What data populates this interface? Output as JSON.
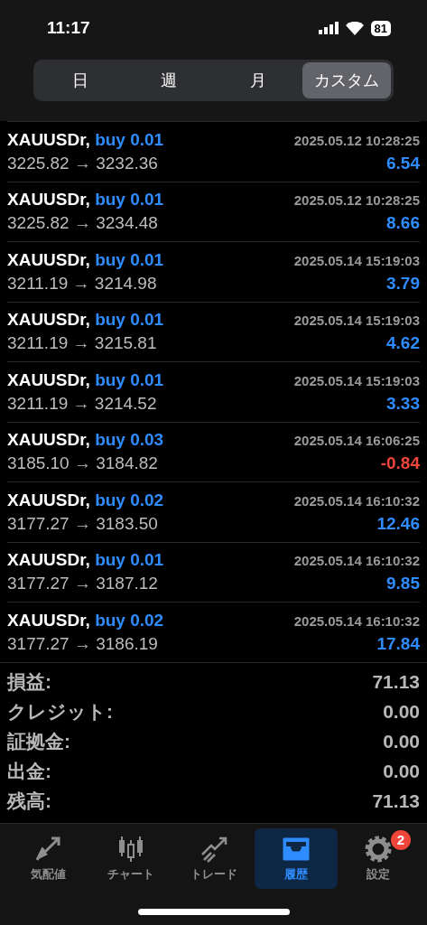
{
  "status_bar": {
    "time": "11:17",
    "battery": "81"
  },
  "segments": [
    {
      "label": "日",
      "selected": false
    },
    {
      "label": "週",
      "selected": false
    },
    {
      "label": "月",
      "selected": false
    },
    {
      "label": "カスタム",
      "selected": true
    }
  ],
  "deals": [
    {
      "symbol": "XAUUSDr,",
      "side": "buy 0.01",
      "time": "2025.05.12 10:28:25",
      "prices": "3225.82 → 3232.36",
      "profit": "6.54",
      "color": "#2f8cff"
    },
    {
      "symbol": "XAUUSDr,",
      "side": "buy 0.01",
      "time": "2025.05.12 10:28:25",
      "prices": "3225.82 → 3234.48",
      "profit": "8.66",
      "color": "#2f8cff"
    },
    {
      "symbol": "XAUUSDr,",
      "side": "buy 0.01",
      "time": "2025.05.14 15:19:03",
      "prices": "3211.19 → 3214.98",
      "profit": "3.79",
      "color": "#2f8cff"
    },
    {
      "symbol": "XAUUSDr,",
      "side": "buy 0.01",
      "time": "2025.05.14 15:19:03",
      "prices": "3211.19 → 3215.81",
      "profit": "4.62",
      "color": "#2f8cff"
    },
    {
      "symbol": "XAUUSDr,",
      "side": "buy 0.01",
      "time": "2025.05.14 15:19:03",
      "prices": "3211.19 → 3214.52",
      "profit": "3.33",
      "color": "#2f8cff"
    },
    {
      "symbol": "XAUUSDr,",
      "side": "buy 0.03",
      "time": "2025.05.14 16:06:25",
      "prices": "3185.10 → 3184.82",
      "profit": "-0.84",
      "color": "#f0453a"
    },
    {
      "symbol": "XAUUSDr,",
      "side": "buy 0.02",
      "time": "2025.05.14 16:10:32",
      "prices": "3177.27 → 3183.50",
      "profit": "12.46",
      "color": "#2f8cff"
    },
    {
      "symbol": "XAUUSDr,",
      "side": "buy 0.01",
      "time": "2025.05.14 16:10:32",
      "prices": "3177.27 → 3187.12",
      "profit": "9.85",
      "color": "#2f8cff"
    },
    {
      "symbol": "XAUUSDr,",
      "side": "buy 0.02",
      "time": "2025.05.14 16:10:32",
      "prices": "3177.27 → 3186.19",
      "profit": "17.84",
      "color": "#2f8cff"
    }
  ],
  "summary": [
    {
      "label": "損益:",
      "value": "71.13"
    },
    {
      "label": "クレジット:",
      "value": "0.00"
    },
    {
      "label": "証拠金:",
      "value": "0.00"
    },
    {
      "label": "出金:",
      "value": "0.00"
    },
    {
      "label": "残高:",
      "value": "71.13"
    }
  ],
  "tab_bar": [
    {
      "kind": "quotes",
      "label": "気配値",
      "selected": false
    },
    {
      "kind": "chart",
      "label": "チャート",
      "selected": false
    },
    {
      "kind": "trade",
      "label": "トレード",
      "selected": false
    },
    {
      "kind": "history",
      "label": "履歴",
      "selected": true
    },
    {
      "kind": "settings",
      "label": "設定",
      "selected": false,
      "badge": "2"
    }
  ]
}
